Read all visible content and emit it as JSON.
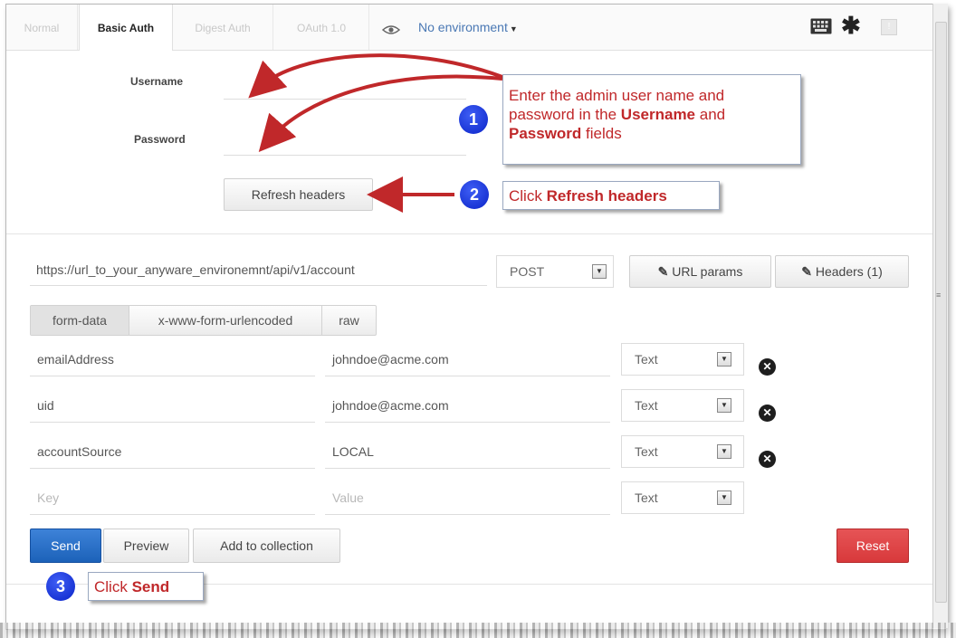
{
  "tabs": [
    "Normal",
    "Basic Auth",
    "Digest Auth",
    "OAuth 1.0"
  ],
  "environment": "No environment",
  "auth": {
    "username_label": "Username",
    "password_label": "Password",
    "refresh_label": "Refresh headers"
  },
  "request": {
    "url": "https://url_to_your_anyware_environemnt/api/v1/account",
    "method": "POST",
    "url_params_label": "URL params",
    "headers_label": "Headers (1)"
  },
  "body_modes": [
    "form-data",
    "x-www-form-urlencoded",
    "raw"
  ],
  "params": [
    {
      "key": "emailAddress",
      "value": "johndoe@acme.com",
      "type": "Text"
    },
    {
      "key": "uid",
      "value": "johndoe@acme.com",
      "type": "Text"
    },
    {
      "key": "accountSource",
      "value": "LOCAL",
      "type": "Text"
    }
  ],
  "new_param": {
    "key_placeholder": "Key",
    "value_placeholder": "Value",
    "type": "Text"
  },
  "actions": {
    "send": "Send",
    "preview": "Preview",
    "add_to_collection": "Add to collection",
    "reset": "Reset"
  },
  "callouts": {
    "one": {
      "number": "1",
      "line1": "Enter the admin user name and",
      "line2_pre": "password in the ",
      "line2_bold": "Username",
      "line2_post": " and",
      "line3_bold": "Password",
      "line3_post": " fields"
    },
    "two": {
      "number": "2",
      "pre": "Click ",
      "bold": "Refresh headers"
    },
    "three": {
      "number": "3",
      "pre": "Click ",
      "bold": "Send"
    }
  },
  "colors": {
    "accent": "#4a78b4",
    "send_button": "#1c62b9",
    "reset_button": "#d8393b",
    "callout_text": "#c0282a",
    "badge": "#0b24c8"
  }
}
